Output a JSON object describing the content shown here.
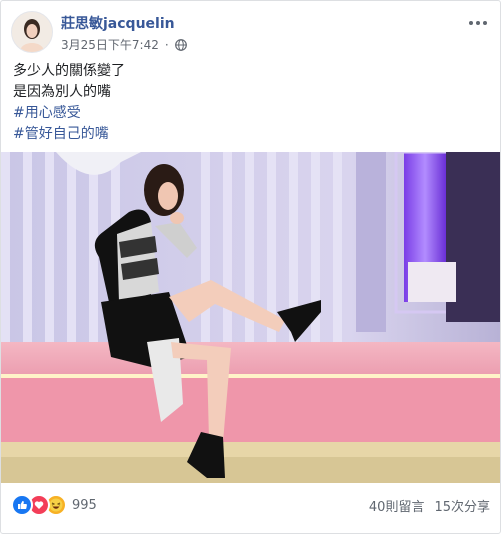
{
  "post": {
    "author": "莊思敏jacquelin",
    "timestamp": "3月25日下午7:42",
    "privacy_icon": "globe-icon",
    "lines": [
      "多少人的關係變了",
      "是因為別人的嘴"
    ],
    "hashtags": [
      "#用心感受",
      "#管好自己的嘴"
    ]
  },
  "footer": {
    "reaction_icons": [
      "like-icon",
      "love-icon",
      "haha-icon"
    ],
    "reaction_count": "995",
    "comments": "40則留言",
    "shares": "15次分享"
  },
  "colors": {
    "link": "#385898",
    "like": "#1877f2",
    "love": "#f33e58",
    "haha": "#f7b125"
  }
}
